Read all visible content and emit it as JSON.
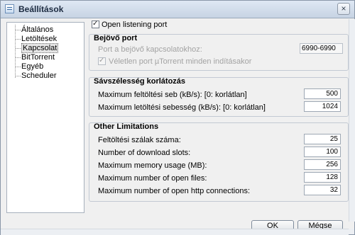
{
  "window": {
    "title": "Beállítások",
    "close_glyph": "×"
  },
  "sidebar": {
    "items": [
      {
        "label": "Általános"
      },
      {
        "label": "Letöltések"
      },
      {
        "label": "Kapcsolat"
      },
      {
        "label": "BitTorrent"
      },
      {
        "label": "Egyéb"
      },
      {
        "label": "Scheduler"
      }
    ]
  },
  "listening": {
    "label": "Open listening port",
    "checked": true
  },
  "port_group": {
    "title": "Bejövő port",
    "port_label": "Port a bejövő kapcsolatokhoz:",
    "port_value": "6990-6990",
    "random_label": "Véletlen port µTorrent minden indításakor",
    "random_checked": true
  },
  "bandwidth": {
    "title": "Sávszélesség korlátozás",
    "upload_label": "Maximum feltöltési seb (kB/s): [0: korlátlan]",
    "upload_value": "500",
    "download_label": "Maximum letöltési sebesség (kB/s): [0: korlátlan]",
    "download_value": "1024"
  },
  "limits": {
    "title": "Other Limitations",
    "rows": [
      {
        "label": "Feltöltési szálak száma:",
        "value": "25"
      },
      {
        "label": "Number of download slots:",
        "value": "100"
      },
      {
        "label": "Maximum memory usage (MB):",
        "value": "256"
      },
      {
        "label": "Maximum number of open files:",
        "value": "128"
      },
      {
        "label": "Maximum number of open http connections:",
        "value": "32"
      }
    ]
  },
  "buttons": {
    "ok": "OK",
    "cancel": "Mégse"
  }
}
